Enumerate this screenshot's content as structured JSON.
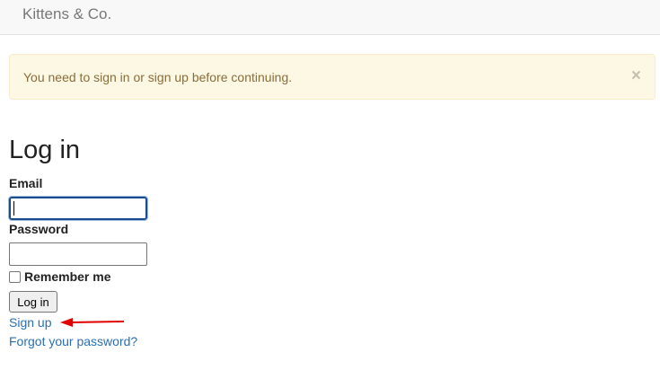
{
  "navbar": {
    "brand": "Kittens & Co."
  },
  "alert": {
    "message": "You need to sign in or sign up before continuing.",
    "close_symbol": "×",
    "background_color": "#fcf8e3",
    "text_color": "#8a6d3b"
  },
  "login": {
    "heading": "Log in",
    "email_label": "Email",
    "email_value": "",
    "password_label": "Password",
    "password_value": "",
    "remember_label": "Remember me",
    "remember_checked": false,
    "submit_label": "Log in"
  },
  "links": {
    "sign_up": "Sign up",
    "forgot_password": "Forgot your password?",
    "link_color": "#2a6fb4"
  },
  "annotation": {
    "arrow_color": "#e00000",
    "icon": "left-arrow-icon"
  }
}
